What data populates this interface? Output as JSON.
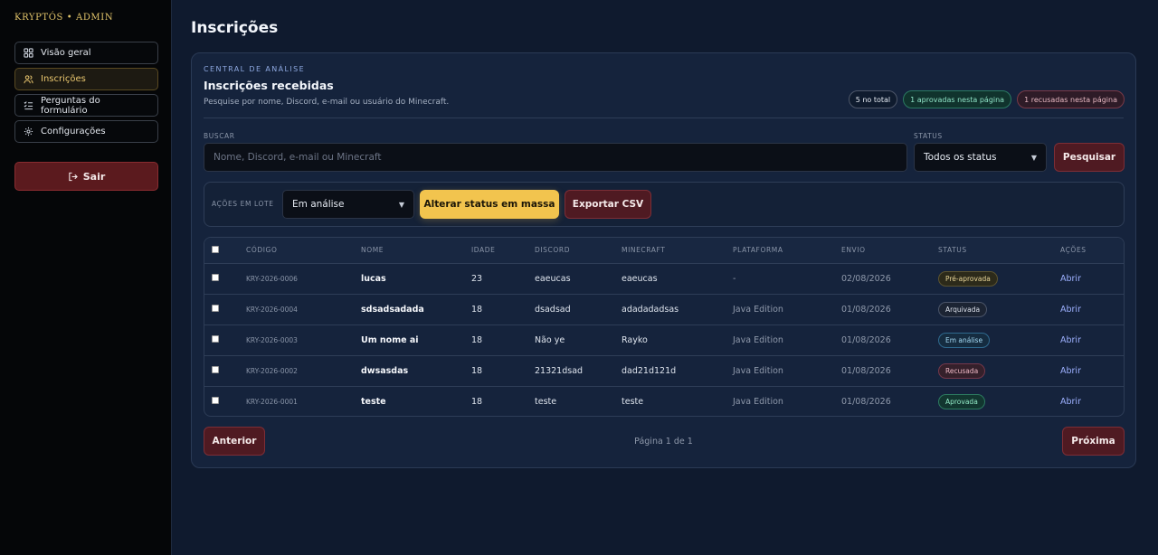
{
  "brand": "KRYPTÓS • ADMIN",
  "sidebar": {
    "items": [
      {
        "label": "Visão geral",
        "icon": "grid-icon"
      },
      {
        "label": "Inscrições",
        "icon": "users-icon",
        "active": true
      },
      {
        "label": "Perguntas do formulário",
        "icon": "list-check-icon"
      },
      {
        "label": "Configurações",
        "icon": "gear-icon"
      }
    ],
    "logout_label": "Sair"
  },
  "page": {
    "title": "Inscrições"
  },
  "card": {
    "kicker": "CENTRAL DE ANÁLISE",
    "title": "Inscrições recebidas",
    "subtitle": "Pesquise por nome, Discord, e-mail ou usuário do Minecraft.",
    "badges": {
      "total": "5 no total",
      "approved": "1 aprovadas nesta página",
      "rejected": "1 recusadas nesta página"
    }
  },
  "search": {
    "label": "BUSCAR",
    "placeholder": "Nome, Discord, e-mail ou Minecraft",
    "status_label": "STATUS",
    "status_value": "Todos os status",
    "button": "Pesquisar"
  },
  "bulk": {
    "label": "AÇÕES EM LOTE",
    "select_value": "Em análise",
    "apply_button": "Alterar status em massa",
    "export_button": "Exportar CSV"
  },
  "table": {
    "headers": {
      "code": "CÓDIGO",
      "name": "NOME",
      "age": "IDADE",
      "discord": "DISCORD",
      "minecraft": "MINECRAFT",
      "platform": "PLATAFORMA",
      "sent": "ENVIO",
      "status": "STATUS",
      "actions": "AÇÕES"
    },
    "rows": [
      {
        "code": "KRY-2026-0006",
        "name": "lucas",
        "age": "23",
        "discord": "eaeucas",
        "minecraft": "eaeucas",
        "platform": "-",
        "sent": "02/08/2026",
        "status": "Pré-aprovada",
        "status_kind": "pre",
        "action": "Abrir"
      },
      {
        "code": "KRY-2026-0004",
        "name": "sdsadsadada",
        "age": "18",
        "discord": "dsadsad",
        "minecraft": "adadadadsas",
        "platform": "Java Edition",
        "sent": "01/08/2026",
        "status": "Arquivada",
        "status_kind": "arq",
        "action": "Abrir"
      },
      {
        "code": "KRY-2026-0003",
        "name": "Um nome ai",
        "age": "18",
        "discord": "Não ye",
        "minecraft": "Rayko",
        "platform": "Java Edition",
        "sent": "01/08/2026",
        "status": "Em análise",
        "status_kind": "ana",
        "action": "Abrir"
      },
      {
        "code": "KRY-2026-0002",
        "name": "dwsasdas",
        "age": "18",
        "discord": "21321dsad",
        "minecraft": "dad21d121d",
        "platform": "Java Edition",
        "sent": "01/08/2026",
        "status": "Recusada",
        "status_kind": "rec",
        "action": "Abrir"
      },
      {
        "code": "KRY-2026-0001",
        "name": "teste",
        "age": "18",
        "discord": "teste",
        "minecraft": "teste",
        "platform": "Java Edition",
        "sent": "01/08/2026",
        "status": "Aprovada",
        "status_kind": "apr",
        "action": "Abrir"
      }
    ]
  },
  "pager": {
    "prev": "Anterior",
    "info": "Página 1 de 1",
    "next": "Próxima"
  },
  "colors": {
    "accent_gold": "#e8c56e",
    "danger": "#5b1a1e",
    "primary_yellow": "#f2c44e",
    "link": "#9db0ff"
  }
}
